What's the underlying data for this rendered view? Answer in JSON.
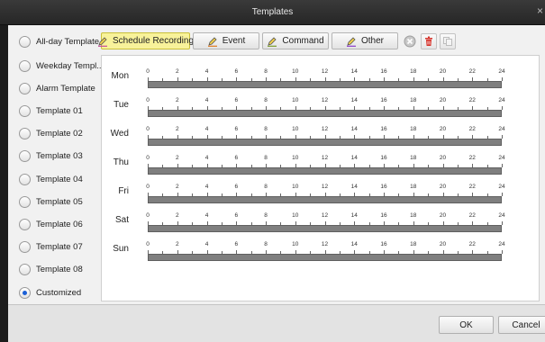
{
  "window": {
    "title": "Templates",
    "close_glyph": "×"
  },
  "templates": [
    {
      "label": "All-day Template",
      "checked": false
    },
    {
      "label": "Weekday Templ...",
      "checked": false
    },
    {
      "label": "Alarm Template",
      "checked": false
    },
    {
      "label": "Template 01",
      "checked": false
    },
    {
      "label": "Template 02",
      "checked": false
    },
    {
      "label": "Template 03",
      "checked": false
    },
    {
      "label": "Template 04",
      "checked": false
    },
    {
      "label": "Template 05",
      "checked": false
    },
    {
      "label": "Template 06",
      "checked": false
    },
    {
      "label": "Template 07",
      "checked": false
    },
    {
      "label": "Template 08",
      "checked": false
    },
    {
      "label": "Customized",
      "checked": true
    }
  ],
  "toolbar": {
    "schedule_recording": "Schedule Recording",
    "event": "Event",
    "command": "Command",
    "other": "Other",
    "icons": [
      "clear-icon",
      "delete-icon",
      "copy-icon"
    ]
  },
  "schedule": {
    "days": [
      "Mon",
      "Tue",
      "Wed",
      "Thu",
      "Fri",
      "Sat",
      "Sun"
    ],
    "hour_labels": [
      "0",
      "2",
      "4",
      "6",
      "8",
      "10",
      "12",
      "14",
      "16",
      "18",
      "20",
      "22",
      "24"
    ],
    "bar_color": "#7f7f7f"
  },
  "footer": {
    "ok": "OK",
    "cancel": "Cancel"
  },
  "colors": {
    "active_tool": "#f8f29a",
    "radio_dot": "#1a5fd6"
  }
}
